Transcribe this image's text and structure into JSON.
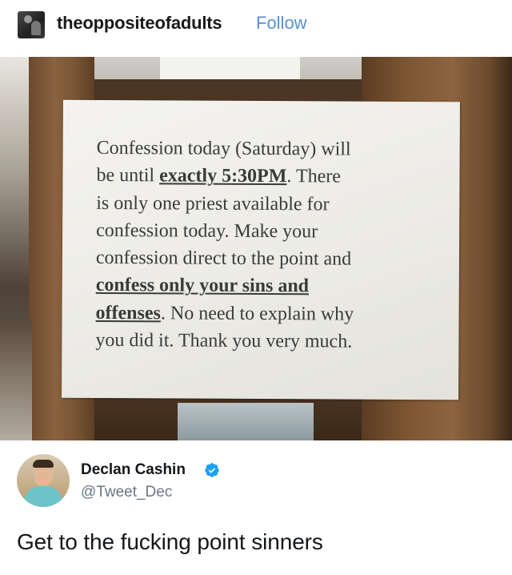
{
  "post": {
    "blog_name": "theoppositeofadults",
    "follow_label": "Follow",
    "avatar_icon": "blog-avatar-icon",
    "follow_color": "#5a8fd0"
  },
  "sign": {
    "lines": [
      "Confession today (Saturday) will",
      "be until ",
      "is only one priest available for",
      "confession today. Make your",
      "confession direct to the point and",
      "",
      "",
      "you did it. Thank you very much."
    ],
    "line2_emph": "exactly 5:30PM",
    "line2_after": ". There",
    "line6_emph": "confess only your sins and",
    "line7_emph": "offenses",
    "line7_after": ". No need to explain why"
  },
  "tweet": {
    "author_name": "Declan Cashin",
    "handle": "@Tweet_Dec",
    "text": "Get to the fucking point sinners",
    "verified_icon": "verified-badge-icon",
    "verified_color": "#1da1f2"
  }
}
